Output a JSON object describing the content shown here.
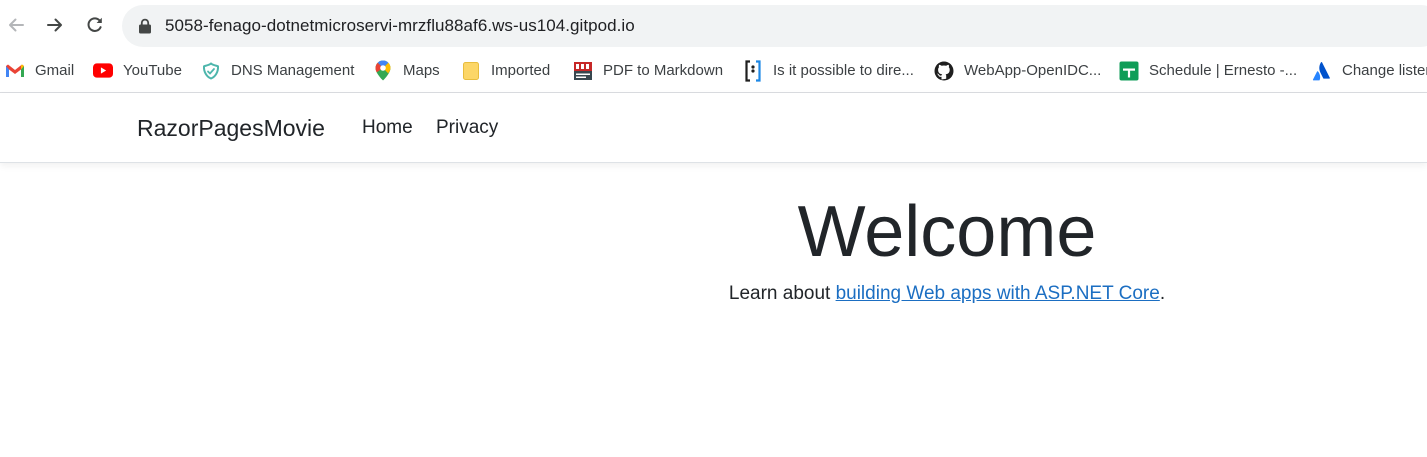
{
  "browser": {
    "url": "5058-fenago-dotnetmicroservi-mrzflu88af6.ws-us104.gitpod.io",
    "icons": {
      "back": "arrow-left-icon",
      "forward": "arrow-right-icon",
      "reload": "reload-icon",
      "lock": "lock-icon"
    }
  },
  "bookmarks": [
    {
      "label": "Gmail",
      "icon": "gmail-icon"
    },
    {
      "label": "YouTube",
      "icon": "youtube-icon"
    },
    {
      "label": "DNS Management",
      "icon": "dns-management-icon"
    },
    {
      "label": "Maps",
      "icon": "maps-pin-icon"
    },
    {
      "label": "Imported",
      "icon": "folder-icon"
    },
    {
      "label": "PDF to Markdown",
      "icon": "pdf-icon"
    },
    {
      "label": "Is it possible to dire...",
      "icon": "bracket-icon"
    },
    {
      "label": "WebApp-OpenIDC...",
      "icon": "github-icon"
    },
    {
      "label": "Schedule | Ernesto -...",
      "icon": "sheets-icon"
    },
    {
      "label": "Change listen",
      "icon": "atlassian-icon"
    }
  ],
  "navbar": {
    "brand": "RazorPagesMovie",
    "links": [
      "Home",
      "Privacy"
    ]
  },
  "main": {
    "heading": "Welcome",
    "text_before": "Learn about ",
    "link_text": "building Web apps with ASP.NET Core",
    "text_after": "."
  },
  "colors": {
    "link": "#1b6ec2",
    "text": "#212529",
    "omnibox": "#f1f3f4"
  }
}
